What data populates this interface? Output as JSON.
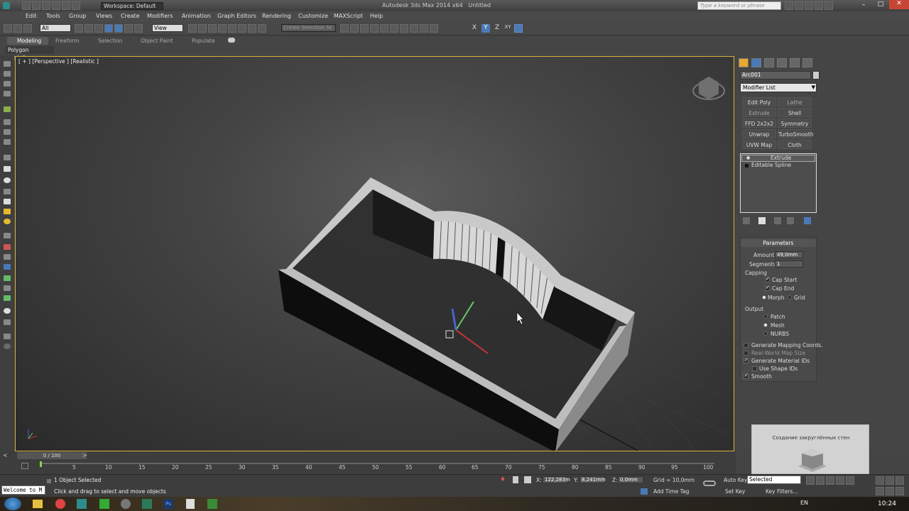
{
  "window": {
    "workspace": "Workspace: Default",
    "title": "Autodesk 3ds Max 2014 x64",
    "doc": "Untitled",
    "search_placeholder": "Type a keyword or phrase"
  },
  "menu": [
    "Edit",
    "Tools",
    "Group",
    "Views",
    "Create",
    "Modifiers",
    "Animation",
    "Graph Editors",
    "Rendering",
    "Customize",
    "MAXScript",
    "Help"
  ],
  "toolbar": {
    "filter": "All",
    "refcoord": "View",
    "selection_set": "Create Selection Se",
    "axes": [
      "X",
      "Y",
      "Z",
      "XY"
    ]
  },
  "ribbon": {
    "tabs": [
      "Modeling",
      "Freeform",
      "Selection",
      "Object Paint",
      "Populate"
    ],
    "subtab": "Polygon Modeling"
  },
  "viewport": {
    "label": "[ + ] [Perspective ] [Realistic ]"
  },
  "panel": {
    "object_name": "Arc001",
    "modifier_list": "Modifier List",
    "buttons": [
      [
        "Edit Poly",
        "Lathe"
      ],
      [
        "Extrude",
        "Shell"
      ],
      [
        "FFD 2x2x2",
        "Symmetry"
      ],
      [
        "Unwrap UVW",
        "TurboSmooth"
      ],
      [
        "UVW Map",
        "Cloth"
      ]
    ],
    "stack": [
      "Extrude",
      "Editable Spline"
    ],
    "params": {
      "title": "Parameters",
      "amount_label": "Amount:",
      "amount": "49,0mm",
      "segments_label": "Segments:",
      "segments": "1",
      "capping": "Capping",
      "cap_start": "Cap Start",
      "cap_end": "Cap End",
      "morph": "Morph",
      "grid": "Grid",
      "output": "Output",
      "patch": "Patch",
      "mesh": "Mesh",
      "nurbs": "NURBS",
      "gen_mapping": "Generate Mapping Coords.",
      "realworld": "Real-World Map Size",
      "gen_matids": "Generate Material IDs",
      "use_shapeids": "Use Shape IDs",
      "smooth": "Smooth"
    }
  },
  "timeline": {
    "frame": "0 / 100",
    "ticks": [
      "5",
      "10",
      "15",
      "20",
      "25",
      "30",
      "35",
      "40",
      "45",
      "50",
      "55",
      "60",
      "65",
      "70",
      "75",
      "80",
      "85",
      "90",
      "95",
      "100"
    ]
  },
  "status": {
    "maxscript": "Welcome to M",
    "selected": "1 Object Selected",
    "prompt": "Click and drag to select and move objects",
    "x": "122,283m",
    "y": "8,241mm",
    "z": "0,0mm",
    "grid": "Grid = 10,0mm",
    "autokey": "Auto Key",
    "setkey": "Set Key",
    "key_sel": "Selected",
    "key_filters": "Key Filters...",
    "add_time_tag": "Add Time Tag"
  },
  "overlay": {
    "caption": "Создание закруглённых стен"
  },
  "taskbar": {
    "lang": "EN",
    "clock": "10:24"
  }
}
